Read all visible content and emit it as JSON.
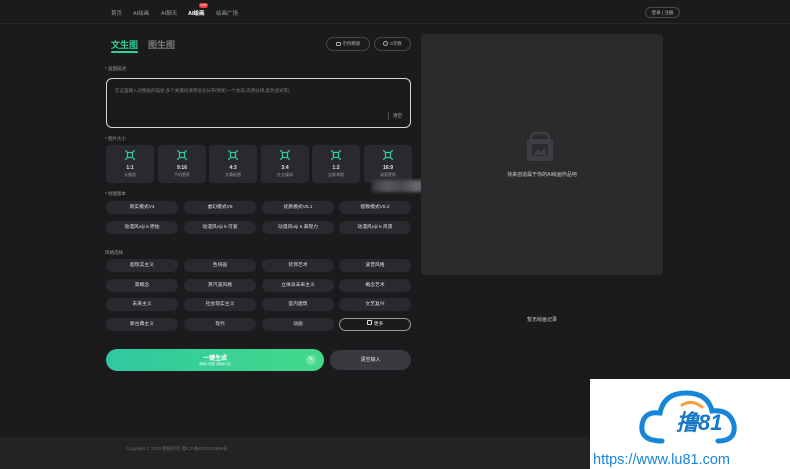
{
  "nav": {
    "items": [
      "首页",
      "AI绘画",
      "AI聊天",
      "AI绘画",
      "绘画广场"
    ],
    "hot_badge": "HOT",
    "login_label": "登录 | 注册"
  },
  "modes": {
    "text_to_image": "文生图",
    "image_to_image": "图生图",
    "pill_left": "示例模板",
    "pill_right": "0次数"
  },
  "prompt": {
    "section_label": "* 画面描述",
    "placeholder": "在这里输入对图画的描述,多个关键词请用逗号分开(例如:一个女孩,高清分辨,柔色滤光等)",
    "clear_label": "清空"
  },
  "size": {
    "section_label": "* 图片大小",
    "options": [
      {
        "ratio": "1:1",
        "desc": "头像图"
      },
      {
        "ratio": "9:16",
        "desc": "手机壁纸"
      },
      {
        "ratio": "4:3",
        "desc": "文章配图"
      },
      {
        "ratio": "3:4",
        "desc": "社交媒体"
      },
      {
        "ratio": "1:2",
        "desc": "全屏海报"
      },
      {
        "ratio": "16:9",
        "desc": "桌面壁纸"
      }
    ]
  },
  "version": {
    "section_label": "* 绘图版本",
    "options": [
      "真实模式V4",
      "虚幻模式V5",
      "优质模式V5.1",
      "极致模式V5.2",
      "动漫风niji 5 原始",
      "动漫风niji 5 可爱",
      "动漫风niji 5 表现力",
      "动漫风niji 5 风景"
    ]
  },
  "style": {
    "section_label": "风格选择",
    "options": [
      "超现实主义",
      "色块画",
      "装饰艺术",
      "波普风格",
      "高概念",
      "蒸汽波风格",
      "立体派未来主义",
      "概念艺术",
      "未来主义",
      "社会现实主义",
      "室内建筑",
      "文艺复兴",
      "新古典主义",
      "现代",
      "动画"
    ],
    "more_label": "更多"
  },
  "actions": {
    "generate_label": "一键生成",
    "generate_sub": "消耗1次数 (剩余0次)",
    "clear_input_label": "清空输入"
  },
  "preview": {
    "hint": "快来创造属于你的AI绘画作品吧",
    "no_records": "暂无绘画记录"
  },
  "footer": {
    "copyright": "Copyright © 2023 版权所有 蜀ICP备2023001959号"
  },
  "watermark": {
    "brand": "撸81",
    "url": "https://www.lu81.com"
  },
  "colors": {
    "accent": "#2fd09a",
    "background": "#1b1b1d",
    "card": "#2a2a2e",
    "watermark_blue": "#1686d9"
  }
}
